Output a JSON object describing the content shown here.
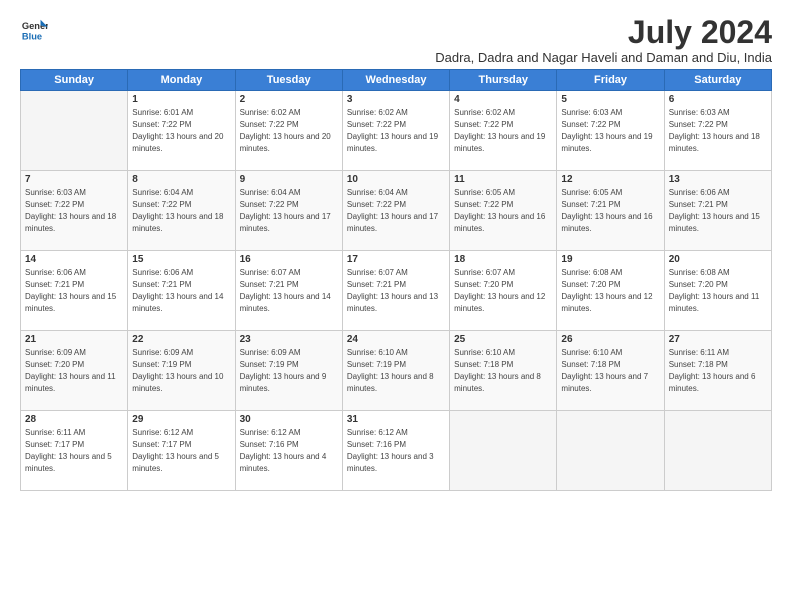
{
  "header": {
    "logo_line1": "General",
    "logo_line2": "Blue",
    "month_year": "July 2024",
    "subtitle": "Dadra, Dadra and Nagar Haveli and Daman and Diu, India"
  },
  "weekdays": [
    "Sunday",
    "Monday",
    "Tuesday",
    "Wednesday",
    "Thursday",
    "Friday",
    "Saturday"
  ],
  "weeks": [
    [
      {
        "day": "",
        "sunrise": "",
        "sunset": "",
        "daylight": ""
      },
      {
        "day": "1",
        "sunrise": "6:01 AM",
        "sunset": "7:22 PM",
        "daylight": "13 hours and 20 minutes."
      },
      {
        "day": "2",
        "sunrise": "6:02 AM",
        "sunset": "7:22 PM",
        "daylight": "13 hours and 20 minutes."
      },
      {
        "day": "3",
        "sunrise": "6:02 AM",
        "sunset": "7:22 PM",
        "daylight": "13 hours and 19 minutes."
      },
      {
        "day": "4",
        "sunrise": "6:02 AM",
        "sunset": "7:22 PM",
        "daylight": "13 hours and 19 minutes."
      },
      {
        "day": "5",
        "sunrise": "6:03 AM",
        "sunset": "7:22 PM",
        "daylight": "13 hours and 19 minutes."
      },
      {
        "day": "6",
        "sunrise": "6:03 AM",
        "sunset": "7:22 PM",
        "daylight": "13 hours and 18 minutes."
      }
    ],
    [
      {
        "day": "7",
        "sunrise": "6:03 AM",
        "sunset": "7:22 PM",
        "daylight": "13 hours and 18 minutes."
      },
      {
        "day": "8",
        "sunrise": "6:04 AM",
        "sunset": "7:22 PM",
        "daylight": "13 hours and 18 minutes."
      },
      {
        "day": "9",
        "sunrise": "6:04 AM",
        "sunset": "7:22 PM",
        "daylight": "13 hours and 17 minutes."
      },
      {
        "day": "10",
        "sunrise": "6:04 AM",
        "sunset": "7:22 PM",
        "daylight": "13 hours and 17 minutes."
      },
      {
        "day": "11",
        "sunrise": "6:05 AM",
        "sunset": "7:22 PM",
        "daylight": "13 hours and 16 minutes."
      },
      {
        "day": "12",
        "sunrise": "6:05 AM",
        "sunset": "7:21 PM",
        "daylight": "13 hours and 16 minutes."
      },
      {
        "day": "13",
        "sunrise": "6:06 AM",
        "sunset": "7:21 PM",
        "daylight": "13 hours and 15 minutes."
      }
    ],
    [
      {
        "day": "14",
        "sunrise": "6:06 AM",
        "sunset": "7:21 PM",
        "daylight": "13 hours and 15 minutes."
      },
      {
        "day": "15",
        "sunrise": "6:06 AM",
        "sunset": "7:21 PM",
        "daylight": "13 hours and 14 minutes."
      },
      {
        "day": "16",
        "sunrise": "6:07 AM",
        "sunset": "7:21 PM",
        "daylight": "13 hours and 14 minutes."
      },
      {
        "day": "17",
        "sunrise": "6:07 AM",
        "sunset": "7:21 PM",
        "daylight": "13 hours and 13 minutes."
      },
      {
        "day": "18",
        "sunrise": "6:07 AM",
        "sunset": "7:20 PM",
        "daylight": "13 hours and 12 minutes."
      },
      {
        "day": "19",
        "sunrise": "6:08 AM",
        "sunset": "7:20 PM",
        "daylight": "13 hours and 12 minutes."
      },
      {
        "day": "20",
        "sunrise": "6:08 AM",
        "sunset": "7:20 PM",
        "daylight": "13 hours and 11 minutes."
      }
    ],
    [
      {
        "day": "21",
        "sunrise": "6:09 AM",
        "sunset": "7:20 PM",
        "daylight": "13 hours and 11 minutes."
      },
      {
        "day": "22",
        "sunrise": "6:09 AM",
        "sunset": "7:19 PM",
        "daylight": "13 hours and 10 minutes."
      },
      {
        "day": "23",
        "sunrise": "6:09 AM",
        "sunset": "7:19 PM",
        "daylight": "13 hours and 9 minutes."
      },
      {
        "day": "24",
        "sunrise": "6:10 AM",
        "sunset": "7:19 PM",
        "daylight": "13 hours and 8 minutes."
      },
      {
        "day": "25",
        "sunrise": "6:10 AM",
        "sunset": "7:18 PM",
        "daylight": "13 hours and 8 minutes."
      },
      {
        "day": "26",
        "sunrise": "6:10 AM",
        "sunset": "7:18 PM",
        "daylight": "13 hours and 7 minutes."
      },
      {
        "day": "27",
        "sunrise": "6:11 AM",
        "sunset": "7:18 PM",
        "daylight": "13 hours and 6 minutes."
      }
    ],
    [
      {
        "day": "28",
        "sunrise": "6:11 AM",
        "sunset": "7:17 PM",
        "daylight": "13 hours and 5 minutes."
      },
      {
        "day": "29",
        "sunrise": "6:12 AM",
        "sunset": "7:17 PM",
        "daylight": "13 hours and 5 minutes."
      },
      {
        "day": "30",
        "sunrise": "6:12 AM",
        "sunset": "7:16 PM",
        "daylight": "13 hours and 4 minutes."
      },
      {
        "day": "31",
        "sunrise": "6:12 AM",
        "sunset": "7:16 PM",
        "daylight": "13 hours and 3 minutes."
      },
      {
        "day": "",
        "sunrise": "",
        "sunset": "",
        "daylight": ""
      },
      {
        "day": "",
        "sunrise": "",
        "sunset": "",
        "daylight": ""
      },
      {
        "day": "",
        "sunrise": "",
        "sunset": "",
        "daylight": ""
      }
    ]
  ]
}
